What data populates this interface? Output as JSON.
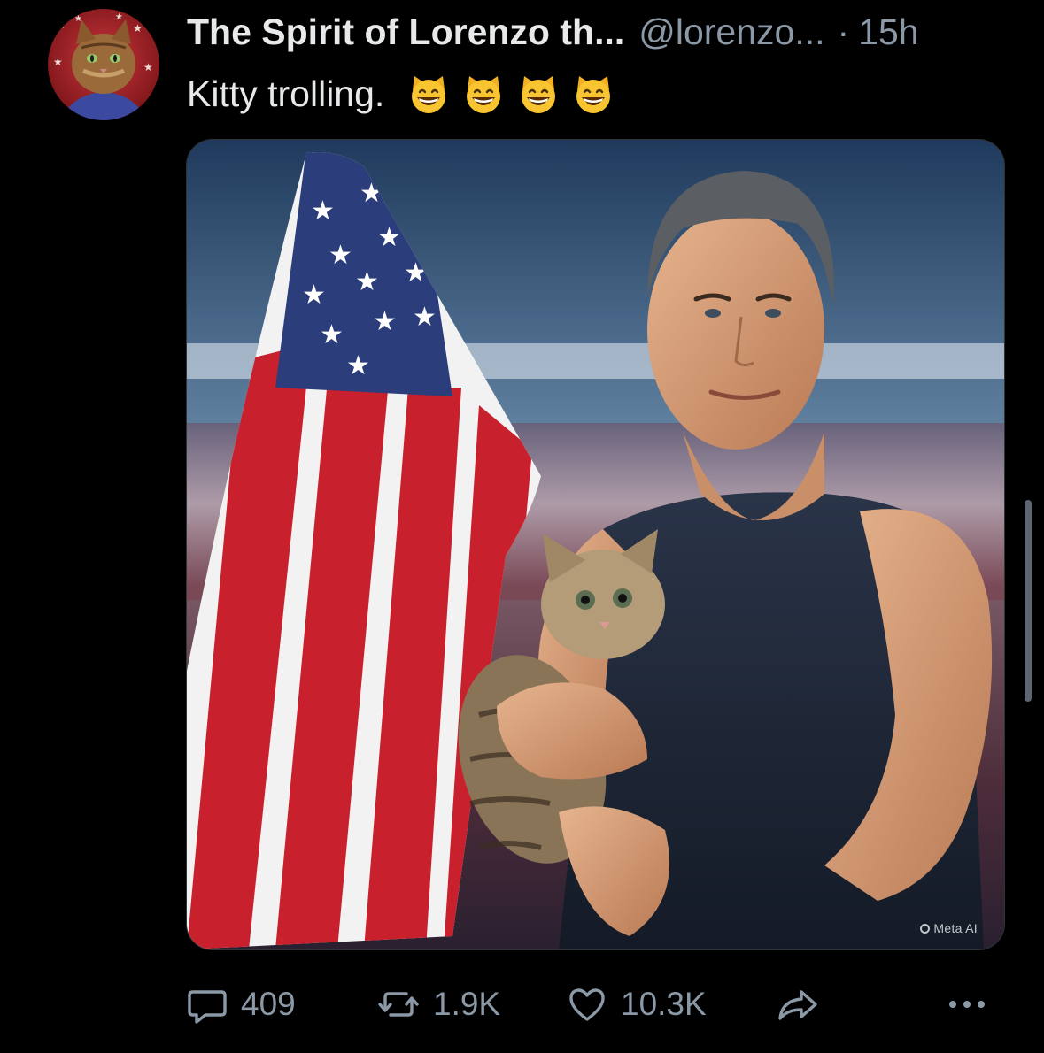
{
  "tweet": {
    "display_name": "The Spirit of Lorenzo th...",
    "handle": "@lorenzo...",
    "separator": "·",
    "timestamp": "15h",
    "text": "Kitty trolling.",
    "emoji_icons": [
      "grinning-cat-icon",
      "grinning-cat-icon",
      "grinning-cat-icon",
      "grinning-cat-icon"
    ],
    "media_watermark": "Meta AI"
  },
  "actions": {
    "replies": "409",
    "reposts": "1.9K",
    "likes": "10.3K"
  },
  "icons": {
    "reply": "comment-bubble-icon",
    "repost": "repost-arrows-icon",
    "like": "heart-icon",
    "share": "share-arrow-icon",
    "more": "more-dots-icon"
  },
  "colors": {
    "background": "#000000",
    "primary_text": "#e7e9ea",
    "secondary_text": "#8b98a5",
    "emoji_yellow": "#f8c531"
  }
}
